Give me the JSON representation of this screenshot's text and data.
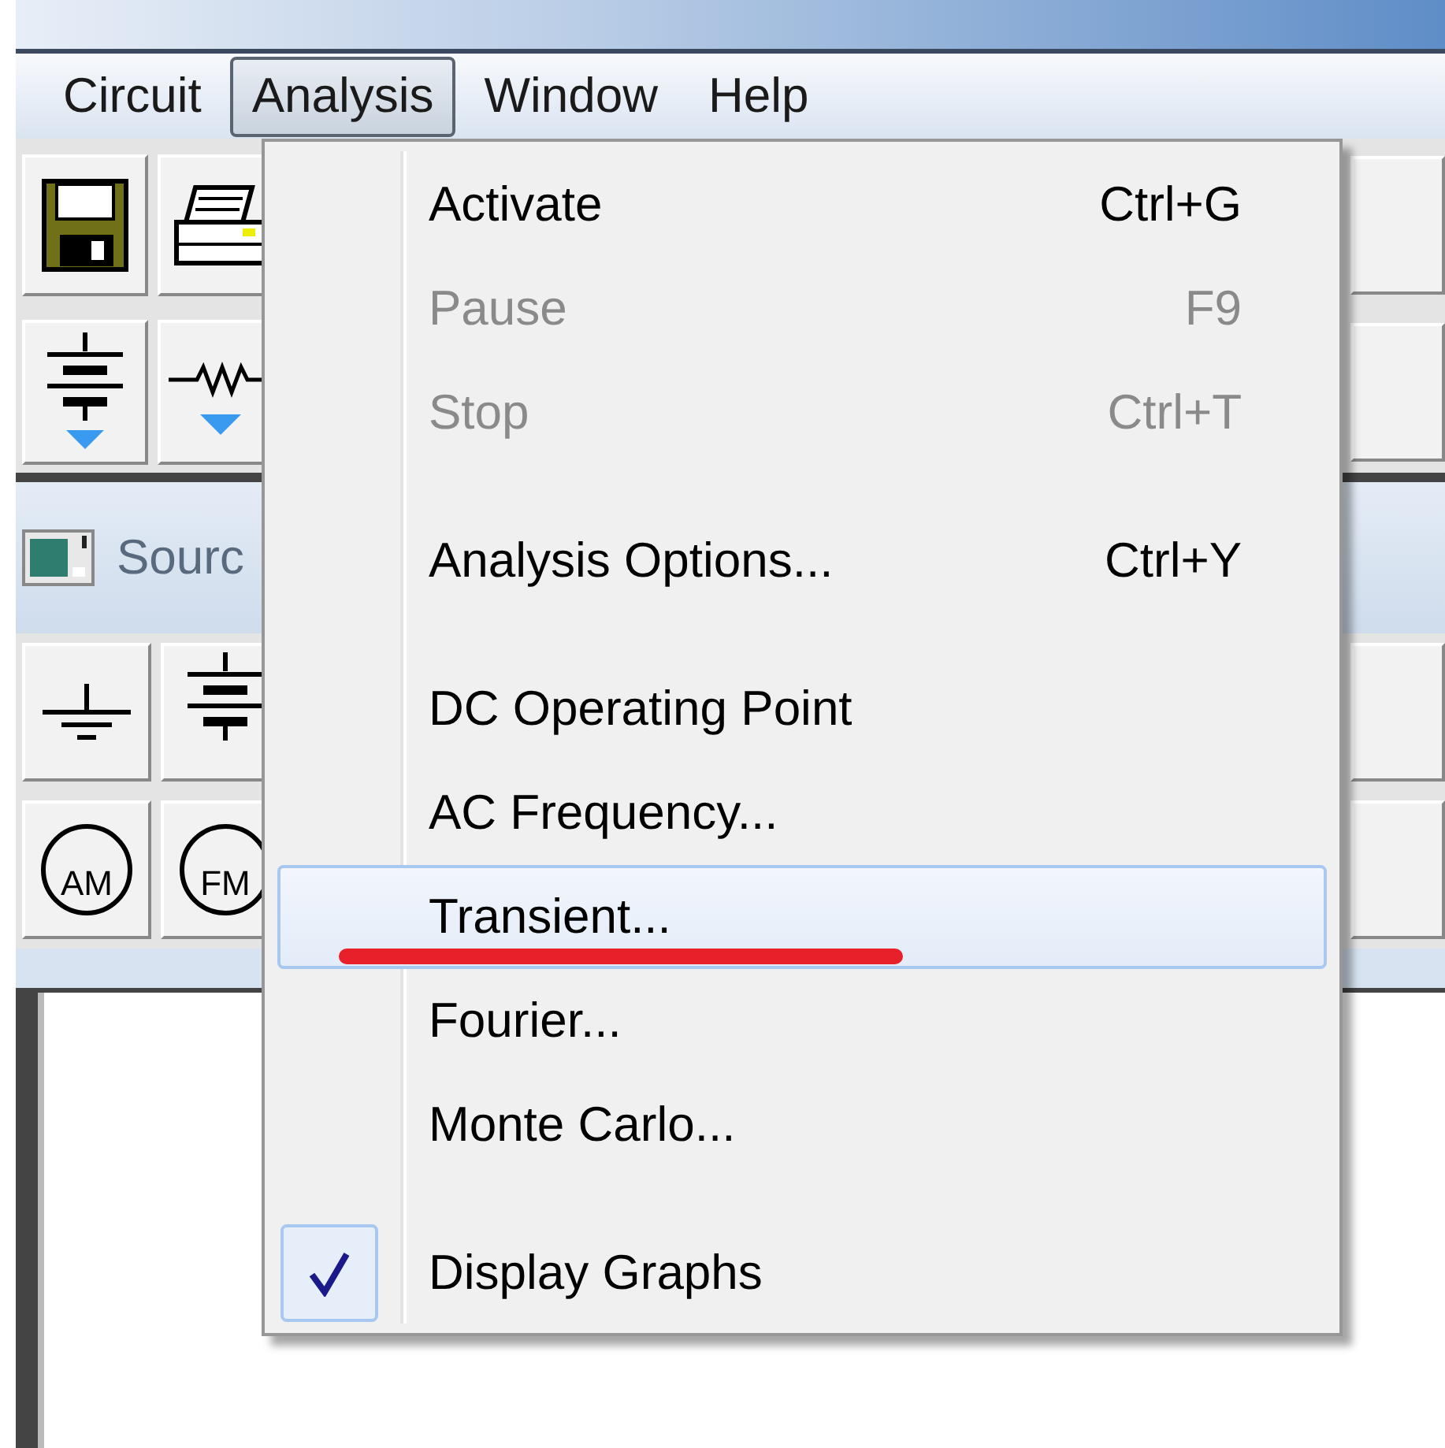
{
  "menubar": [
    {
      "label": "Circuit",
      "selected": false
    },
    {
      "label": "Analysis",
      "selected": true
    },
    {
      "label": "Window",
      "selected": false
    },
    {
      "label": "Help",
      "selected": false
    }
  ],
  "toolbar": [
    {
      "kind": "save"
    },
    {
      "kind": "print"
    }
  ],
  "component_toolbar": [
    {
      "kind": "battery"
    },
    {
      "kind": "resistor"
    }
  ],
  "panel": {
    "title": "Sourc"
  },
  "parts_rows": [
    [
      {
        "kind": "ground"
      },
      {
        "kind": "battery"
      }
    ],
    [
      {
        "kind": "source",
        "label": "AM"
      },
      {
        "kind": "source",
        "label": "FM"
      }
    ]
  ],
  "menu": {
    "items": [
      {
        "kind": "item",
        "label": "Activate",
        "shortcut": "Ctrl+G",
        "disabled": false,
        "selected": false,
        "checked": false,
        "underlined": false
      },
      {
        "kind": "item",
        "label": "Pause",
        "shortcut": "F9",
        "disabled": true,
        "selected": false,
        "checked": false,
        "underlined": false
      },
      {
        "kind": "item",
        "label": "Stop",
        "shortcut": "Ctrl+T",
        "disabled": true,
        "selected": false,
        "checked": false,
        "underlined": false
      },
      {
        "kind": "separator"
      },
      {
        "kind": "item",
        "label": "Analysis Options...",
        "shortcut": "Ctrl+Y",
        "disabled": false,
        "selected": false,
        "checked": false,
        "underlined": false
      },
      {
        "kind": "separator"
      },
      {
        "kind": "item",
        "label": "DC Operating Point",
        "disabled": false,
        "selected": false,
        "checked": false,
        "underlined": false
      },
      {
        "kind": "item",
        "label": "AC Frequency...",
        "disabled": false,
        "selected": false,
        "checked": false,
        "underlined": false
      },
      {
        "kind": "item",
        "label": "Transient...",
        "disabled": false,
        "selected": true,
        "checked": false,
        "underlined": true
      },
      {
        "kind": "item",
        "label": "Fourier...",
        "disabled": false,
        "selected": false,
        "checked": false,
        "underlined": false
      },
      {
        "kind": "item",
        "label": "Monte Carlo...",
        "disabled": false,
        "selected": false,
        "checked": false,
        "underlined": false
      },
      {
        "kind": "separator"
      },
      {
        "kind": "item",
        "label": "Display Graphs",
        "disabled": false,
        "selected": false,
        "checked": true,
        "underlined": false
      }
    ]
  }
}
